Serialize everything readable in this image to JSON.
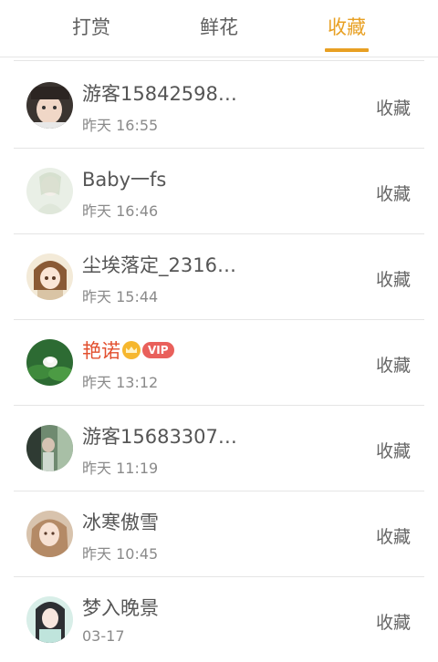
{
  "tabs": [
    {
      "label": "打赏"
    },
    {
      "label": "鲜花"
    },
    {
      "label": "收藏"
    }
  ],
  "active_tab": "收藏",
  "accent_color": "#e8a023",
  "rows": [
    {
      "name": "游客15842598…",
      "time": "昨天 16:55",
      "action": "收藏",
      "vip": false
    },
    {
      "name": "Baby一fs",
      "time": "昨天 16:46",
      "action": "收藏",
      "vip": false
    },
    {
      "name": "尘埃落定_2316…",
      "time": "昨天 15:44",
      "action": "收藏",
      "vip": false
    },
    {
      "name": "艳诺",
      "time": "昨天 13:12",
      "action": "收藏",
      "vip": true,
      "badge": "VIP"
    },
    {
      "name": "游客15683307…",
      "time": "昨天 11:19",
      "action": "收藏",
      "vip": false
    },
    {
      "name": "冰寒傲雪",
      "time": "昨天 10:45",
      "action": "收藏",
      "vip": false
    },
    {
      "name": "梦入晚景",
      "time": "03-17",
      "action": "收藏",
      "vip": false
    }
  ]
}
